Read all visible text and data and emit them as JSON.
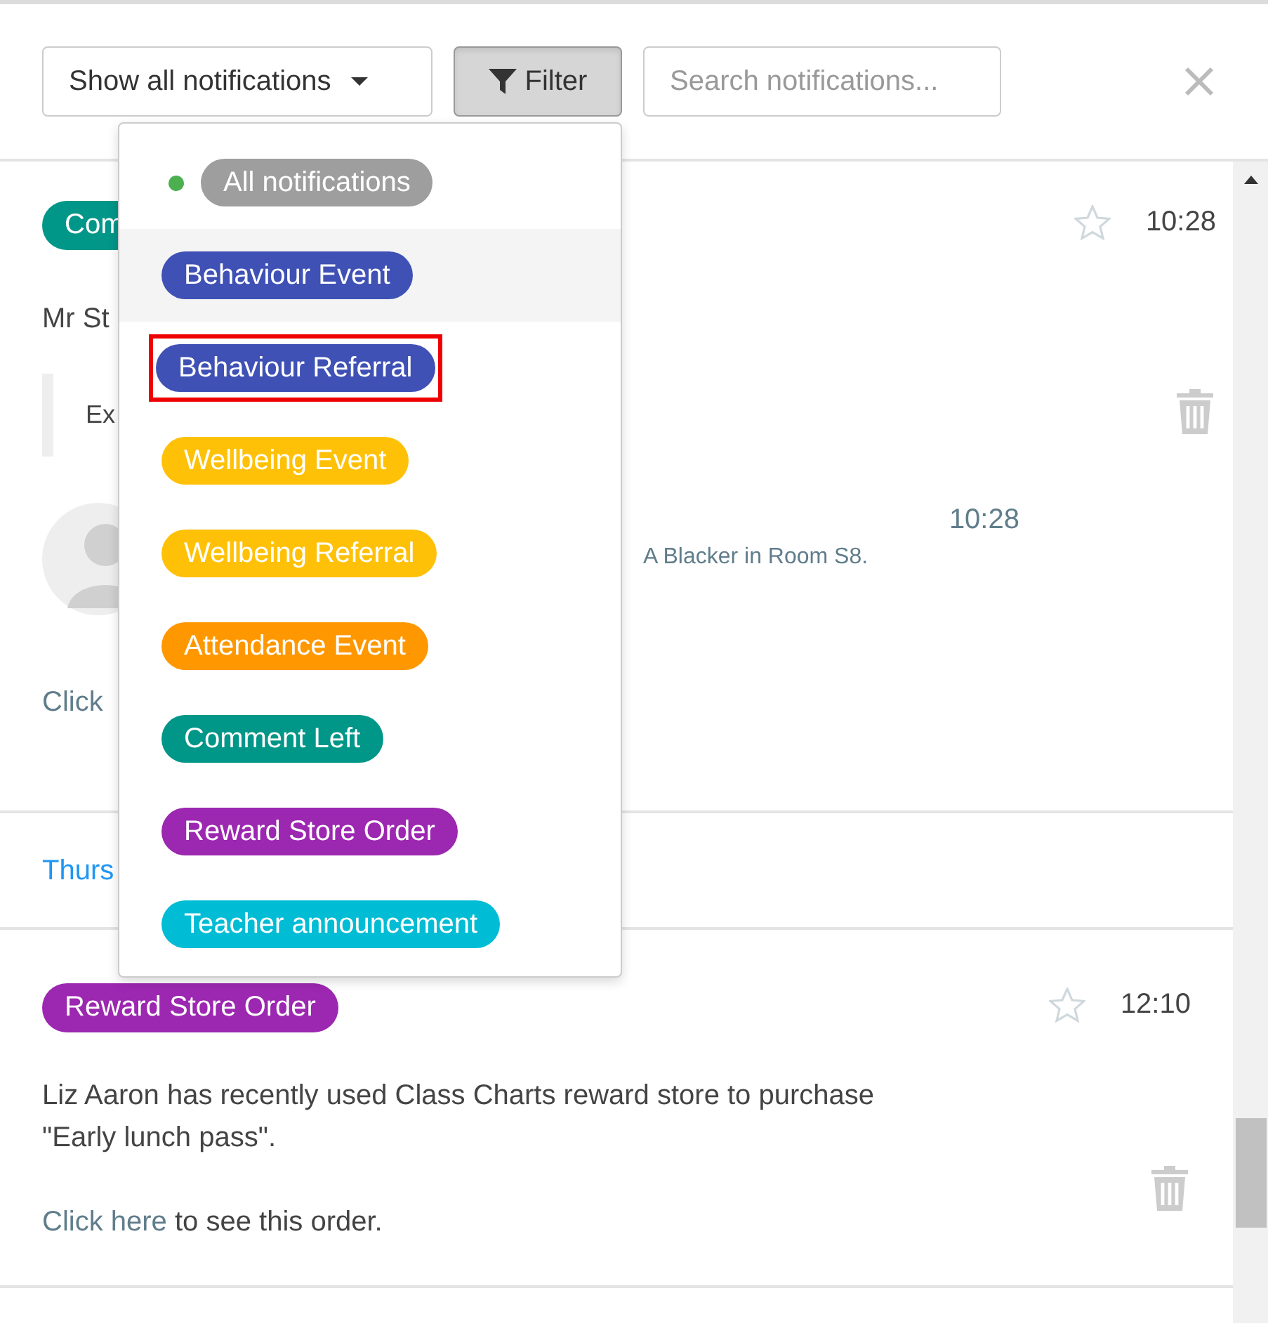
{
  "toolbar": {
    "show_select": {
      "label": "Show all notifications"
    },
    "filter_button": {
      "label": "Filter",
      "active": true
    },
    "search": {
      "placeholder": "Search notifications..."
    }
  },
  "feed": [
    {
      "kind": "notification",
      "tag": "Com",
      "color": "#009688",
      "starred": false,
      "time": "10:28",
      "text": "Mr St",
      "quote": "Ex",
      "reply": {
        "time": "10:28",
        "text": "A Blacker in Room S8."
      },
      "link": "Click"
    },
    {
      "kind": "date",
      "label": "Thurs"
    },
    {
      "kind": "notification",
      "tag": "Reward Store Order",
      "color": "#9c27b0",
      "starred": false,
      "time": "12:10",
      "text": "Liz Aaron has recently used Class Charts reward store to purchase \"Early lunch pass\".",
      "link": "Click here",
      "link_rest": " to see this order."
    }
  ],
  "filter_menu": {
    "items": [
      {
        "label": "All notifications",
        "color": "#9e9e9e",
        "selected": true,
        "hovered": false,
        "highlighted": false
      },
      {
        "label": "Behaviour Event",
        "color": "#3f51b5",
        "selected": false,
        "hovered": true,
        "highlighted": false
      },
      {
        "label": "Behaviour Referral",
        "color": "#3f51b5",
        "selected": false,
        "hovered": false,
        "highlighted": true
      },
      {
        "label": "Wellbeing Event",
        "color": "#ffc107",
        "selected": false,
        "hovered": false,
        "highlighted": false
      },
      {
        "label": "Wellbeing Referral",
        "color": "#ffc107",
        "selected": false,
        "hovered": false,
        "highlighted": false
      },
      {
        "label": "Attendance Event",
        "color": "#ff9800",
        "selected": false,
        "hovered": false,
        "highlighted": false
      },
      {
        "label": "Comment Left",
        "color": "#009688",
        "selected": false,
        "hovered": false,
        "highlighted": false
      },
      {
        "label": "Reward Store Order",
        "color": "#9c27b0",
        "selected": false,
        "hovered": false,
        "highlighted": false
      },
      {
        "label": "Teacher announcement",
        "color": "#00bcd4",
        "selected": false,
        "hovered": false,
        "highlighted": false
      }
    ]
  }
}
